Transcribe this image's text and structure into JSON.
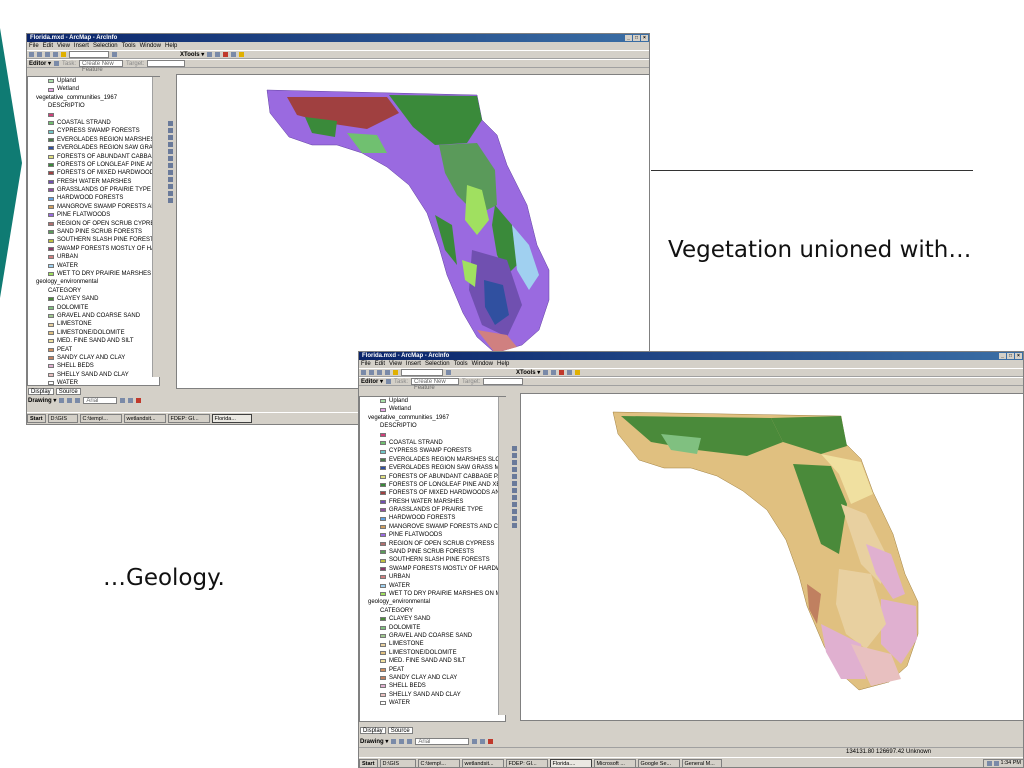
{
  "slide": {
    "caption_top": "Vegetation unioned with…",
    "caption_bottom": "…Geology.",
    "accent_color": "#0f7b73"
  },
  "window1": {
    "title": "Florida.mxd - ArcMap - ArcInfo",
    "menu": [
      "File",
      "Edit",
      "View",
      "Insert",
      "Selection",
      "Tools",
      "Window",
      "Help"
    ],
    "xtools_label": "XTools ▾",
    "editor_label": "Editor ▾",
    "task_label": "Task:",
    "task_value": "Create New Feature",
    "target_label": "Target:",
    "display_tab": "Display",
    "source_tab": "Source",
    "drawing_label": "Drawing ▾",
    "font_value": "Arial",
    "taskbar": {
      "start": "Start",
      "buttons": [
        "D:\\GIS",
        "C:\\temp\\...",
        "wetlandsit...",
        "FDEP: GI...",
        "Florida..."
      ]
    }
  },
  "window2": {
    "title": "Florida.mxd - ArcMap - ArcInfo",
    "menu": [
      "File",
      "Edit",
      "View",
      "Insert",
      "Selection",
      "Tools",
      "Window",
      "Help"
    ],
    "xtools_label": "XTools ▾",
    "editor_label": "Editor ▾",
    "task_label": "Task:",
    "task_value": "Create New Feature",
    "target_label": "Target:",
    "display_tab": "Display",
    "source_tab": "Source",
    "drawing_label": "Drawing ▾",
    "font_value": "Arial",
    "status_coords": "134131.80  126697.42 Unknown",
    "taskbar": {
      "start": "Start",
      "buttons": [
        "D:\\GIS",
        "C:\\temp\\...",
        "wetlandsit...",
        "FDEP: GI...",
        "Florida....",
        "Microsoft ...",
        "Google Se...",
        "General M..."
      ],
      "clock": "1:34 PM"
    }
  },
  "toc": {
    "wetland_group": [
      {
        "label": "Upland",
        "color": "#a8e0a8"
      },
      {
        "label": "Wetland",
        "color": "#e8a8e8"
      }
    ],
    "veg_layer": "vegetative_communities_1967",
    "veg_field": "DESCRIPTIO",
    "veg_items": [
      {
        "label": "",
        "color": "#d0407a"
      },
      {
        "label": "COASTAL STRAND",
        "color": "#70c070"
      },
      {
        "label": "CYPRESS SWAMP FORESTS",
        "color": "#6fc7c7"
      },
      {
        "label": "EVERGLADES REGION MARSHES SLOUGHS",
        "color": "#4a7a4a"
      },
      {
        "label": "EVERGLADES REGION SAW GRASS MARSHES",
        "color": "#3050a0"
      },
      {
        "label": "FORESTS OF ABUNDANT CABBAGE PALMS",
        "color": "#e0e080"
      },
      {
        "label": "FORESTS OF LONGLEAF PINE AND XEROPHYTIC",
        "color": "#3a8a3a"
      },
      {
        "label": "FORESTS OF MIXED HARDWOODS AND PINE",
        "color": "#a04040"
      },
      {
        "label": "FRESH WATER MARSHES",
        "color": "#7050b0"
      },
      {
        "label": "GRASSLANDS OF PRAIRIE TYPE",
        "color": "#9050a0"
      },
      {
        "label": "HARDWOOD FORESTS",
        "color": "#60a0e0"
      },
      {
        "label": "MANGROVE SWAMP FORESTS AND COASTAL",
        "color": "#d0a060"
      },
      {
        "label": "PINE FLATWOODS",
        "color": "#9a6ae0"
      },
      {
        "label": "REGION OF OPEN SCRUB CYPRESS",
        "color": "#b07070"
      },
      {
        "label": "SAND PINE SCRUB FORESTS",
        "color": "#5a9a5a"
      },
      {
        "label": "SOUTHERN SLASH PINE FORESTS",
        "color": "#c0c040"
      },
      {
        "label": "SWAMP FORESTS MOSTLY OF HARDWOODS",
        "color": "#8a3a6a"
      },
      {
        "label": "URBAN",
        "color": "#d08080"
      },
      {
        "label": "WATER",
        "color": "#a0d0f0"
      },
      {
        "label": "WET TO DRY PRAIRIE MARSHES ON MARL",
        "color": "#a0e060"
      }
    ],
    "geo_layer": "geology_environmental",
    "geo_field": "CATEGORY",
    "geo_items": [
      {
        "label": "CLAYEY SAND",
        "color": "#4a8a3a"
      },
      {
        "label": "DOLOMITE",
        "color": "#80c080"
      },
      {
        "label": "GRAVEL AND COARSE SAND",
        "color": "#a0c890"
      },
      {
        "label": "LIMESTONE",
        "color": "#e8d0a0"
      },
      {
        "label": "LIMESTONE/DOLOMITE",
        "color": "#e0c080"
      },
      {
        "label": "MED. FINE SAND AND SILT",
        "color": "#f0e0a0"
      },
      {
        "label": "PEAT",
        "color": "#d09060"
      },
      {
        "label": "SANDY CLAY AND CLAY",
        "color": "#c08060"
      },
      {
        "label": "SHELL BEDS",
        "color": "#e0b0d0"
      },
      {
        "label": "SHELLY SAND AND CLAY",
        "color": "#e8c0c0"
      },
      {
        "label": "WATER",
        "color": "#ffffff"
      }
    ]
  }
}
